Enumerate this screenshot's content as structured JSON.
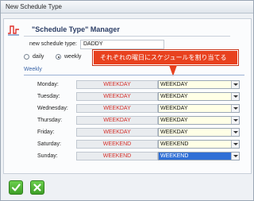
{
  "window": {
    "title": "New Schedule Type"
  },
  "header": {
    "title": "\"Schedule Type\" Manager"
  },
  "form": {
    "name_label": "new schedule type:",
    "name_value": "DADDY",
    "radio_daily": "daily",
    "radio_weekly": "weekly",
    "selected_mode": "weekly"
  },
  "callout": {
    "text": "それぞれの曜日にスケジュールを割り当てる",
    "color": "#e8411e"
  },
  "section": {
    "title": "Weekly"
  },
  "days": [
    {
      "label": "Monday:",
      "current": "WEEKDAY",
      "select": "WEEKDAY"
    },
    {
      "label": "Tuesday:",
      "current": "WEEKDAY",
      "select": "WEEKDAY"
    },
    {
      "label": "Wednesday:",
      "current": "WEEKDAY",
      "select": "WEEKDAY"
    },
    {
      "label": "Thursday:",
      "current": "WEEKDAY",
      "select": "WEEKDAY"
    },
    {
      "label": "Friday:",
      "current": "WEEKDAY",
      "select": "WEEKDAY"
    },
    {
      "label": "Saturday:",
      "current": "WEEKEND",
      "select": "WEEKEND"
    },
    {
      "label": "Sunday:",
      "current": "WEEKEND",
      "select": "WEEKEND"
    }
  ],
  "buttons": {
    "ok_icon": "check-icon",
    "cancel_icon": "close-icon"
  },
  "colors": {
    "accent": "#3a64a8",
    "current_value": "#d4302a",
    "selected_row": "#2f6fd6"
  }
}
